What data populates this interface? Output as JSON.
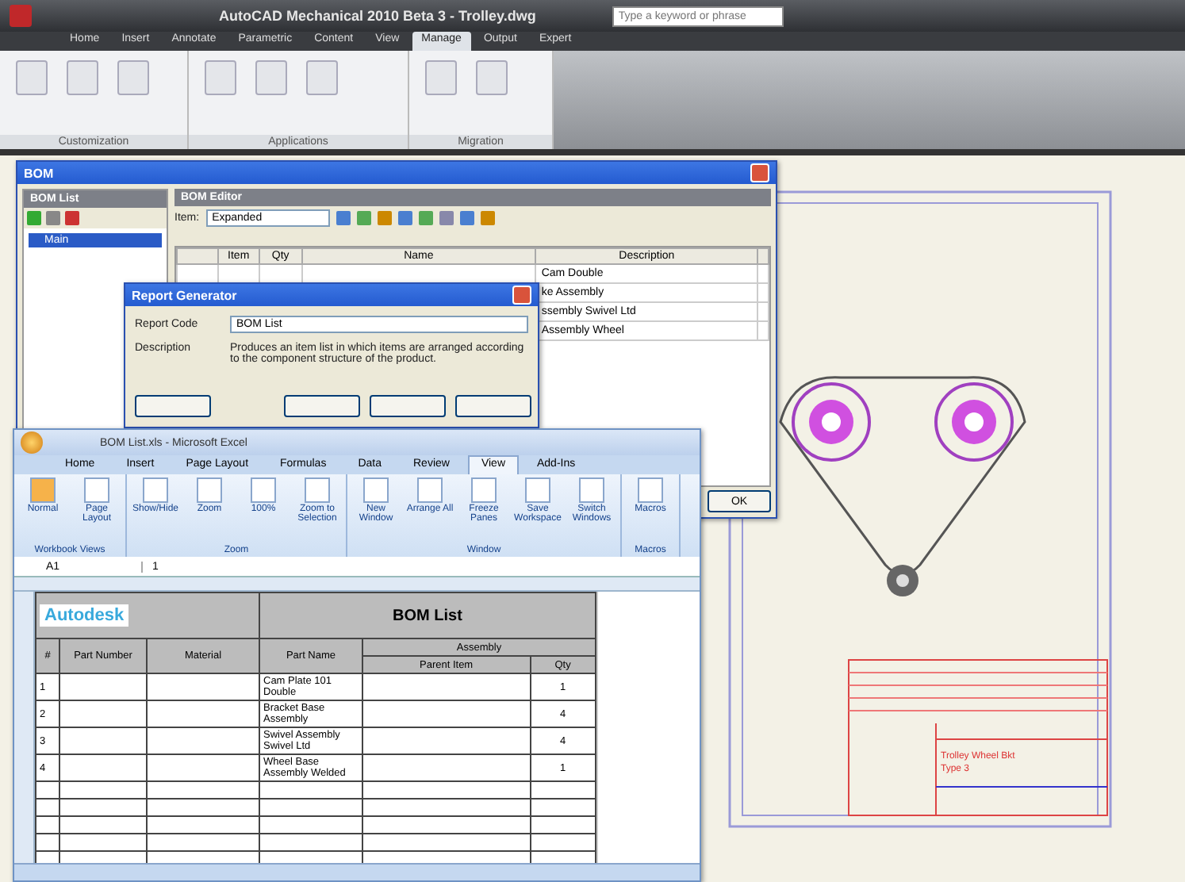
{
  "app": {
    "title": "AutoCAD Mechanical 2010 Beta 3 - Trolley.dwg",
    "search_placeholder": "Type a keyword or phrase"
  },
  "ribbon_tabs": [
    {
      "label": "Home",
      "selected": false
    },
    {
      "label": "Insert",
      "selected": false
    },
    {
      "label": "Annotate",
      "selected": false
    },
    {
      "label": "Parametric",
      "selected": false
    },
    {
      "label": "Content",
      "selected": false
    },
    {
      "label": "View",
      "selected": false
    },
    {
      "label": "Manage",
      "selected": true
    },
    {
      "label": "Output",
      "selected": false
    },
    {
      "label": "Expert",
      "selected": false
    }
  ],
  "ribbon_panels": [
    {
      "label": "Customization"
    },
    {
      "label": "Applications"
    },
    {
      "label": "Migration"
    }
  ],
  "drawing": {
    "title_block": [
      "Trolley Wheel Bkt",
      "Type 3"
    ]
  },
  "bom_window": {
    "title": "BOM",
    "tree_header": "BOM List",
    "tree_items": [
      {
        "label": "Main",
        "selected": true
      }
    ],
    "editor_header": "BOM Editor",
    "view_label": "Item:",
    "view_value": "Expanded",
    "columns": [
      "Item",
      "Qty",
      "Name",
      "Description"
    ],
    "rows": [
      [
        "Cam Double"
      ],
      [
        "ke Assembly"
      ],
      [
        "ssembly Swivel Ltd"
      ],
      [
        "Assembly Wheel"
      ]
    ],
    "close": "OK"
  },
  "report_dialog": {
    "title": "Report Generator",
    "code_label": "Report Code",
    "code_value": "BOM List",
    "description_label": "Description",
    "description": "Produces an item list in which items are arranged according to the component structure of the product."
  },
  "excel": {
    "title": "BOM List.xls - Microsoft Excel",
    "tabs": [
      {
        "label": "Home",
        "selected": false
      },
      {
        "label": "Insert",
        "selected": false
      },
      {
        "label": "Page Layout",
        "selected": false
      },
      {
        "label": "Formulas",
        "selected": false
      },
      {
        "label": "Data",
        "selected": false
      },
      {
        "label": "Review",
        "selected": false
      },
      {
        "label": "View",
        "selected": true
      },
      {
        "label": "Add-Ins",
        "selected": false
      }
    ],
    "groups": [
      {
        "label": "Workbook Views",
        "buttons": [
          "Normal",
          "Page Layout"
        ]
      },
      {
        "label": "Zoom",
        "buttons": [
          "Show/Hide",
          "Zoom",
          "100%",
          "Zoom to Selection"
        ]
      },
      {
        "label": "Window",
        "buttons": [
          "New Window",
          "Arrange All",
          "Freeze Panes",
          "Save Workspace",
          "Switch Windows"
        ]
      },
      {
        "label": "Macros",
        "buttons": [
          "Macros"
        ]
      }
    ],
    "name_box": "A1",
    "formula": "1",
    "sheet": {
      "brand": "Autodesk",
      "title": "BOM List",
      "headers": [
        "#",
        "Part Number",
        "Material",
        "Part Name"
      ],
      "group_header": "Assembly",
      "sub_headers": [
        "Parent Item",
        "Qty"
      ],
      "rows": [
        {
          "num": "1",
          "part_name": "Cam Plate 101 Double",
          "qty": "1"
        },
        {
          "num": "2",
          "part_name": "Bracket Base Assembly",
          "qty": "4"
        },
        {
          "num": "3",
          "part_name": "Swivel Assembly Swivel Ltd",
          "qty": "4"
        },
        {
          "num": "4",
          "part_name": "Wheel Base Assembly Welded",
          "qty": "1"
        }
      ]
    }
  }
}
